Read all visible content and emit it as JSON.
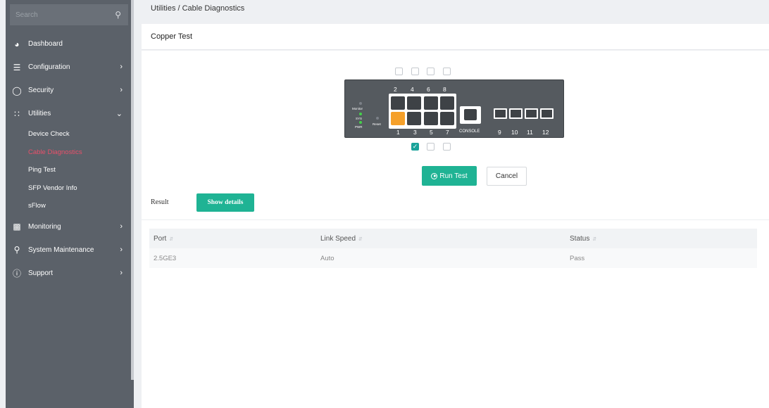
{
  "sidebar": {
    "search_placeholder": "Search",
    "items": [
      {
        "label": "Dashboard",
        "icon": "dashboard-icon"
      },
      {
        "label": "Configuration",
        "icon": "sliders-icon"
      },
      {
        "label": "Security",
        "icon": "shield-icon"
      },
      {
        "label": "Utilities",
        "icon": "grid-icon"
      },
      {
        "label": "Monitoring",
        "icon": "monitor-icon"
      },
      {
        "label": "System Maintenance",
        "icon": "wrench-icon"
      },
      {
        "label": "Support",
        "icon": "question-icon"
      }
    ],
    "utilities_subitems": [
      "Device Check",
      "Cable Diagnostics",
      "Ping Test",
      "SFP Vendor Info",
      "sFlow"
    ],
    "active_subitem": "Cable Diagnostics"
  },
  "breadcrumb": "Utilities / Cable Diagnostics",
  "panel_title": "Copper Test",
  "switch": {
    "top_port_labels": [
      "2",
      "4",
      "6",
      "8"
    ],
    "bottom_port_labels": [
      "1",
      "3",
      "5",
      "7"
    ],
    "sfp_labels": [
      "9",
      "10",
      "11",
      "12"
    ],
    "console_label": "CONSOLE",
    "led_labels": [
      "Monitor",
      "SYS",
      "PWR"
    ],
    "reset_label": "Reset",
    "selected_port": "1"
  },
  "actions": {
    "run_label": "Run Test",
    "cancel_label": "Cancel",
    "result_label": "Result",
    "details_label": "Show details"
  },
  "table": {
    "headers": [
      "Port",
      "Link Speed",
      "Status"
    ],
    "rows": [
      [
        "2.5GE3",
        "Auto",
        "Pass"
      ]
    ]
  },
  "colors": {
    "accent": "#1fb394",
    "active_menu": "#e8506a",
    "selected_port": "#f5a02a"
  }
}
